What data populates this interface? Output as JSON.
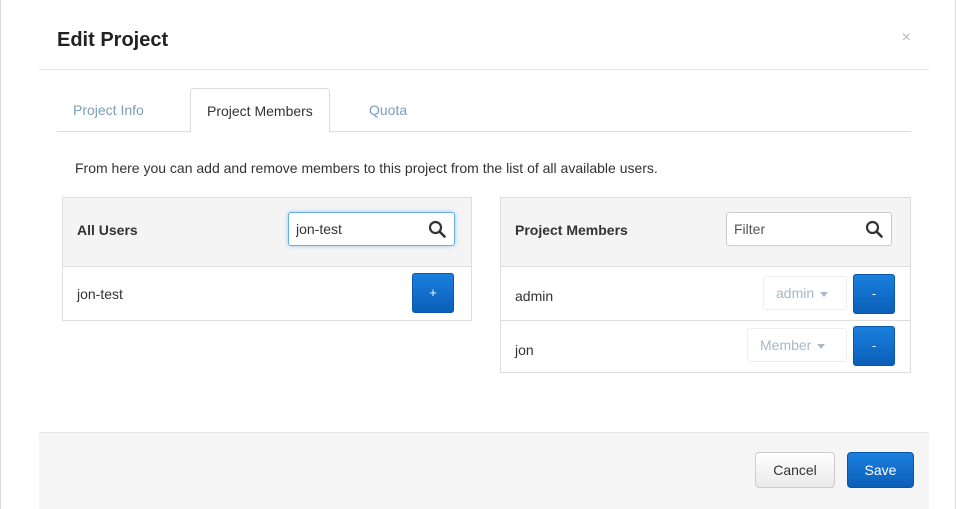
{
  "modal": {
    "title": "Edit Project",
    "close_label": "×"
  },
  "tabs": [
    {
      "label": "Project Info",
      "active": false
    },
    {
      "label": "Project Members",
      "active": true
    },
    {
      "label": "Quota",
      "active": false
    }
  ],
  "help_text": "From here you can add and remove members to this project from the list of all available users.",
  "all_users": {
    "title": "All Users",
    "search_value": "jon-test",
    "rows": [
      {
        "name": "jon-test",
        "action_label": "+"
      }
    ]
  },
  "project_members": {
    "title": "Project Members",
    "filter_placeholder": "Filter",
    "rows": [
      {
        "name": "admin",
        "role": "admin",
        "action_label": "-"
      },
      {
        "name": "jon",
        "role": "Member",
        "action_label": "-"
      }
    ]
  },
  "footer": {
    "cancel_label": "Cancel",
    "save_label": "Save"
  },
  "colors": {
    "primary": "#0b6fd0",
    "link_tab": "#7a9eb8",
    "panel_header": "#f4f4f4"
  },
  "icons": {
    "search": "search-icon",
    "close": "close-icon",
    "dropdown": "chevron-down-icon"
  }
}
